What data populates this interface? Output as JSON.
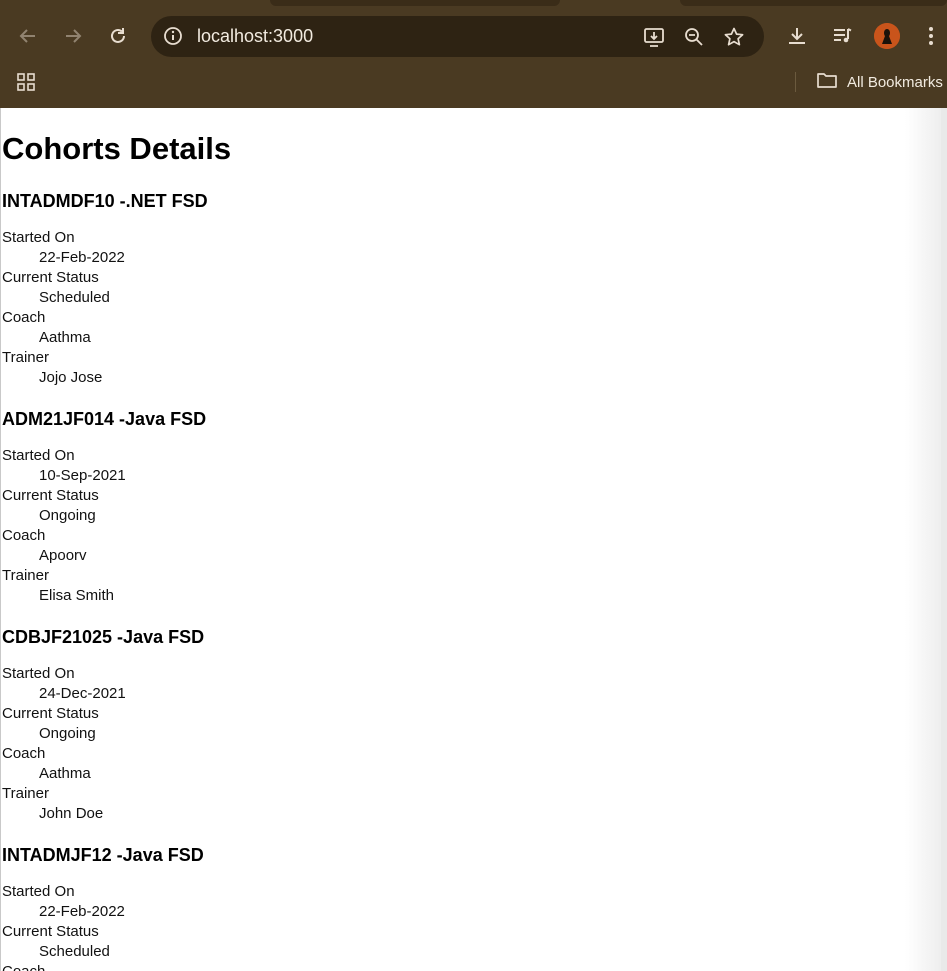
{
  "browser": {
    "url": "localhost:3000",
    "bookmarks_label": "All Bookmarks"
  },
  "page": {
    "title": "Cohorts Details"
  },
  "cohorts": [
    {
      "heading": "INTADMDF10 -.NET FSD",
      "started_label": "Started On",
      "started": "22-Feb-2022",
      "status_label": "Current Status",
      "status": "Scheduled",
      "coach_label": "Coach",
      "coach": "Aathma",
      "trainer_label": "Trainer",
      "trainer": "Jojo Jose"
    },
    {
      "heading": "ADM21JF014 -Java FSD",
      "started_label": "Started On",
      "started": "10-Sep-2021",
      "status_label": "Current Status",
      "status": "Ongoing",
      "coach_label": "Coach",
      "coach": "Apoorv",
      "trainer_label": "Trainer",
      "trainer": "Elisa Smith"
    },
    {
      "heading": "CDBJF21025 -Java FSD",
      "started_label": "Started On",
      "started": "24-Dec-2021",
      "status_label": "Current Status",
      "status": "Ongoing",
      "coach_label": "Coach",
      "coach": "Aathma",
      "trainer_label": "Trainer",
      "trainer": "John Doe"
    },
    {
      "heading": "INTADMJF12 -Java FSD",
      "started_label": "Started On",
      "started": "22-Feb-2022",
      "status_label": "Current Status",
      "status": "Scheduled",
      "coach_label": "Coach",
      "coach": "",
      "trainer_label": "",
      "trainer": ""
    }
  ]
}
